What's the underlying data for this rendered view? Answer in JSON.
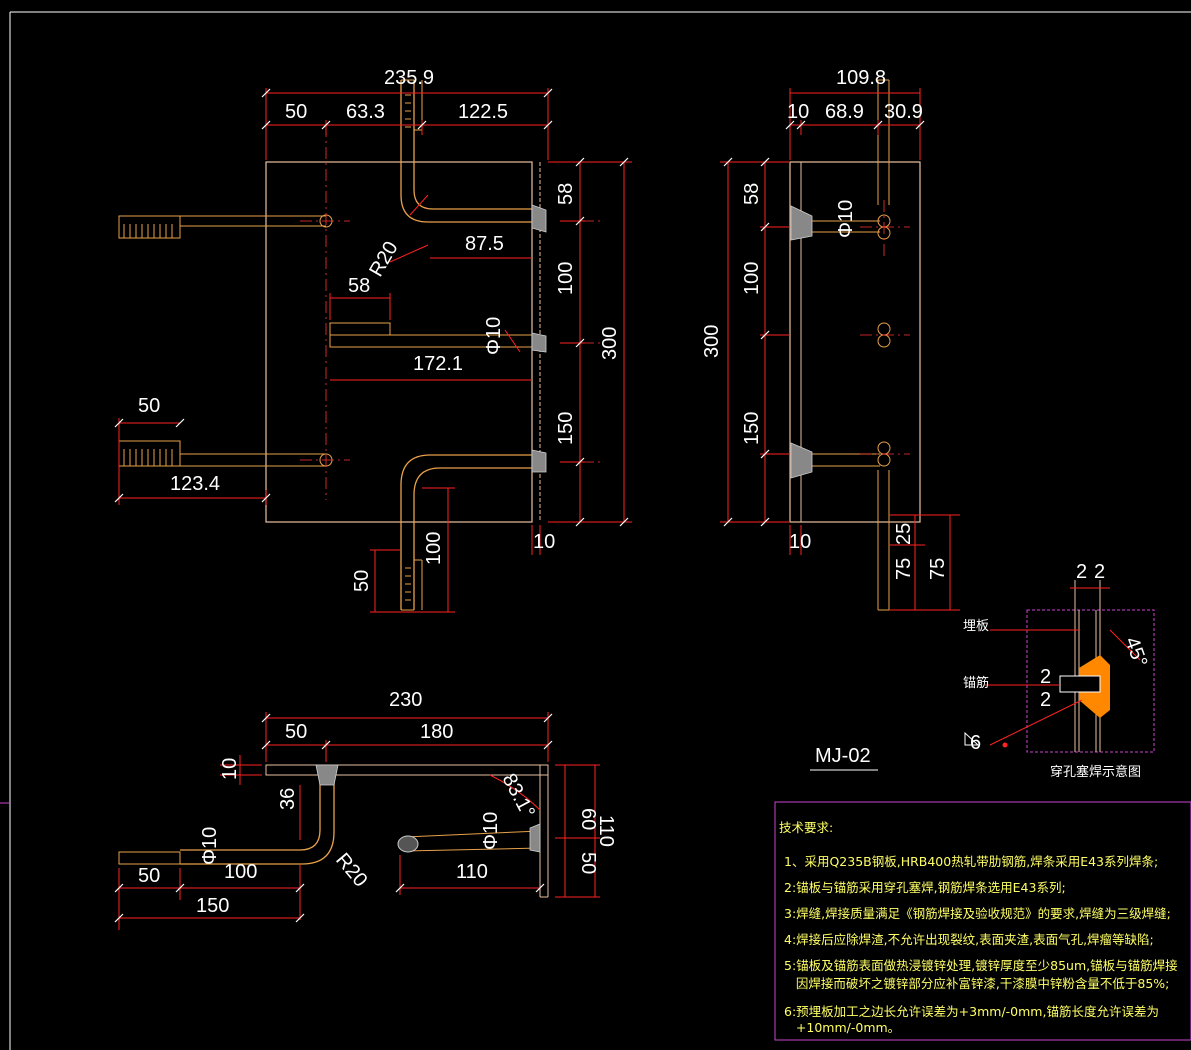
{
  "front_view": {
    "dims": {
      "total_width": "235.9",
      "w50": "50",
      "w63_3": "63.3",
      "w122_5": "122.5",
      "d87_5": "87.5",
      "r20": "R20",
      "l58": "58",
      "d172_1": "172.1",
      "dia10": "Φ10",
      "l50": "50",
      "d123_4": "123.4",
      "v58": "58",
      "v100": "100",
      "v150": "150",
      "v300": "300",
      "b10": "10",
      "b100": "100",
      "b50": "50"
    }
  },
  "side_view": {
    "dims": {
      "total_width": "109.8",
      "w10": "10",
      "w68_9": "68.9",
      "w30_9": "30.9",
      "v58": "58",
      "v100": "100",
      "v150": "150",
      "v300": "300",
      "dia10": "Φ10",
      "b10": "10",
      "b25": "25",
      "b75a": "75",
      "b75b": "75"
    }
  },
  "plan_view": {
    "dims": {
      "total": "230",
      "w50": "50",
      "w180": "180",
      "t10": "10",
      "d36": "36",
      "dia10a": "Φ10",
      "dia10b": "Φ10",
      "angle": "83.1°",
      "r20": "R20",
      "l50": "50",
      "l100": "100",
      "l150": "150",
      "l110": "110",
      "v60": "60",
      "v50": "50",
      "v110": "110"
    }
  },
  "detail": {
    "label_plate": "埋板",
    "label_bar": "锚筋",
    "dim2a": "2",
    "dim2b": "2",
    "dim2c": "2",
    "dim2d": "2",
    "angle": "45°",
    "weld": "6",
    "caption": "穿孔塞焊示意图"
  },
  "part_tag": "MJ-02",
  "notes": {
    "title": "技术要求:",
    "items": [
      "1、采用Q235B钢板,HRB400热轧带肋钢筋,焊条采用E43系列焊条;",
      "2:锚板与锚筋采用穿孔塞焊,钢筋焊条选用E43系列;",
      "3:焊缝,焊接质量满足《钢筋焊接及验收规范》的要求,焊缝为三级焊缝;",
      "4:焊接后应除焊渣,不允许出现裂纹,表面夹渣,表面气孔,焊瘤等缺陷;",
      "5:锚板及锚筋表面做热浸镀锌处理,镀锌厚度至少85um,锚板与锚筋焊接",
      "   因焊接而破坏之镀锌部分应补富锌漆,干漆膜中锌粉含量不低于85%;",
      "6:预埋板加工之边长允许误差为+3mm/-0mm,锚筋长度允许误差为",
      "   +10mm/-0mm。"
    ]
  },
  "colors": {
    "background": "#000000",
    "plate": "#e8a878",
    "rebar": "#e8a04a",
    "dimension": "#ff2222",
    "center": "#ff3333",
    "text": "#ffffff",
    "note_text": "#ffff66",
    "frame": "#cc44cc",
    "weld": "#ff8800"
  }
}
